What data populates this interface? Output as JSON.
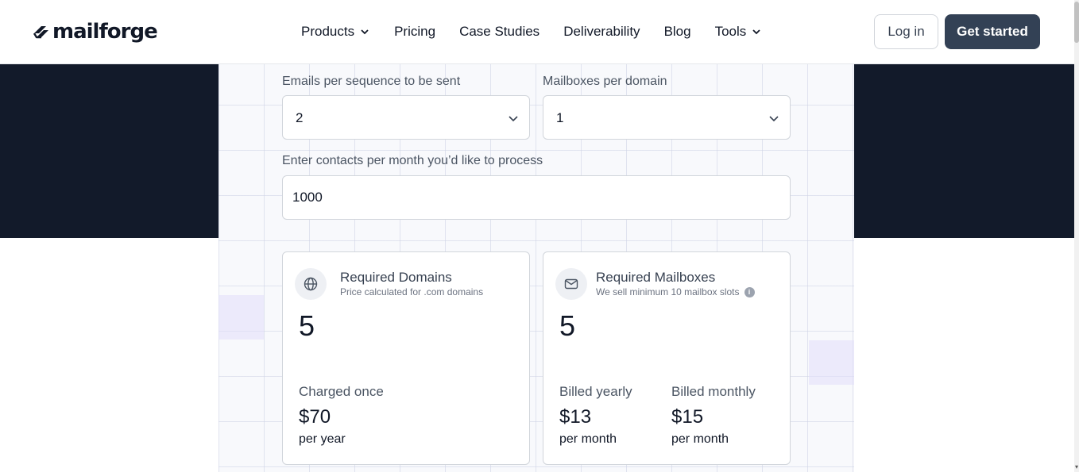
{
  "brand": {
    "name": "mailforge",
    "logo_icon": "mailforge-logo-mark"
  },
  "nav": {
    "items": [
      {
        "label": "Products",
        "has_dropdown": true
      },
      {
        "label": "Pricing",
        "has_dropdown": false
      },
      {
        "label": "Case Studies",
        "has_dropdown": false
      },
      {
        "label": "Deliverability",
        "has_dropdown": false
      },
      {
        "label": "Blog",
        "has_dropdown": false
      },
      {
        "label": "Tools",
        "has_dropdown": true
      }
    ],
    "login_label": "Log in",
    "get_started_label": "Get started"
  },
  "calculator": {
    "emails_per_sequence": {
      "label": "Emails per sequence to be sent",
      "value": "2"
    },
    "mailboxes_per_domain": {
      "label": "Mailboxes per domain",
      "value": "1"
    },
    "contacts": {
      "label": "Enter contacts per month you’d like to process",
      "value": "1000"
    }
  },
  "domains_card": {
    "icon": "globe-icon",
    "title": "Required Domains",
    "subtitle": "Price calculated for .com domains",
    "count": "5",
    "price_label": "Charged once",
    "price": "$70",
    "price_unit": "per year"
  },
  "mailboxes_card": {
    "icon": "mail-icon",
    "title": "Required Mailboxes",
    "subtitle": "We sell minimum 10 mailbox slots",
    "count": "5",
    "yearly_label": "Billed yearly",
    "yearly_price": "$13",
    "yearly_unit": "per month",
    "monthly_label": "Billed monthly",
    "monthly_price": "$15",
    "monthly_unit": "per month"
  },
  "colors": {
    "dark_band": "#121a2a",
    "primary_button": "#334155",
    "panel_bg": "#f8f9fc"
  }
}
